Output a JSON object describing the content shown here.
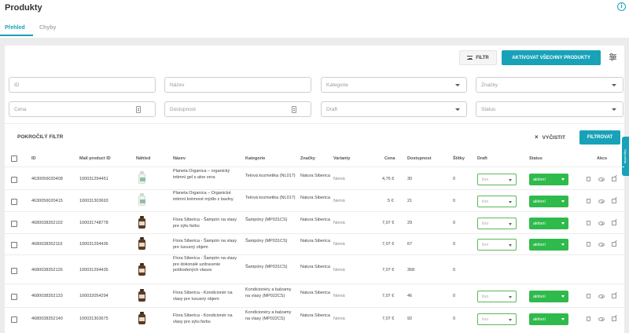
{
  "page": {
    "title": "Produkty"
  },
  "tabs": [
    {
      "label": "Přehled"
    },
    {
      "label": "Chyby"
    }
  ],
  "toolbar": {
    "filter_label": "FILTR",
    "activate_all_label": "AKTIVOVAT VŠECHNY PRODUKTY"
  },
  "filters": {
    "id_placeholder": "ID",
    "name_placeholder": "Název",
    "category_placeholder": "Kategorie",
    "brands_placeholder": "Značky",
    "price_placeholder": "Cena",
    "availability_placeholder": "Dostupnost",
    "draft_placeholder": "Draft",
    "status_placeholder": "Status",
    "advanced_label": "POKROČILÝ FILTR",
    "clear_label": "VYČISTIT",
    "apply_label": "FILTROVAT"
  },
  "table": {
    "headers": {
      "id": "ID",
      "mall_id": "Mall product ID",
      "preview": "Náhled",
      "name": "Název",
      "category": "Kategorie",
      "brands": "Značky",
      "variants": "Varianty",
      "price": "Cena",
      "availability": "Dostupnost",
      "labels": "Štítky",
      "draft": "Draft",
      "status": "Status",
      "actions": "Akce"
    },
    "rows": [
      {
        "id": "4630056020408",
        "mall_id": "100031294451",
        "name": "Planeta Organica – organický intimní gel s aloe vera",
        "category": "Telová kozmetika (NL017)",
        "brand": "Natura Siberica",
        "variant": "Nemá",
        "price": "4,76 €",
        "availability": "30",
        "labels": "0",
        "draft": "ilvo",
        "status": "aktivní"
      },
      {
        "id": "4630056020415",
        "mall_id": "100031303693",
        "name": "Planeta Organica – Organické intimní krémové mýdlo z bavlny",
        "category": "Telová kozmetika (NL017)",
        "brand": "Natura Siberica",
        "variant": "Nemá",
        "price": "5 €",
        "availability": "21",
        "labels": "0",
        "draft": "ilvo",
        "status": "aktivní"
      },
      {
        "id": "4680038352102",
        "mall_id": "100031748778",
        "name": "Flora Siberica - Šampón na vlasy pre sýtu farbu",
        "category": "Šampóny (MP031CS)",
        "brand": "Natura Siberica",
        "variant": "Nemá",
        "price": "7,07 €",
        "availability": "29",
        "labels": "0",
        "draft": "ilvo",
        "status": "aktivní"
      },
      {
        "id": "4680038352119",
        "mall_id": "100031294436",
        "name": "Flora Siberica - Šampón na vlasy pre luxusný objem",
        "category": "Šampóny (MP031CS)",
        "brand": "Natura Siberica",
        "variant": "Nemá",
        "price": "7,07 €",
        "availability": "67",
        "labels": "0",
        "draft": "ilvo",
        "status": "aktivní"
      },
      {
        "id": "4680038352126",
        "mall_id": "100031294435",
        "name": "Flora Siberica - Šampón na vlasy pre dokonalé uzdravenie poškodených vlasov",
        "category": "Šampóny (MP031CS)",
        "brand": "Natura Siberica",
        "variant": "Nemá",
        "price": "7,07 €",
        "availability": "368",
        "labels": "0",
        "draft": "ilvo",
        "status": "aktivní"
      },
      {
        "id": "4680038352133",
        "mall_id": "100032054294",
        "name": "Flora Siberica - Kondicionér na vlasy pre luxusný objem",
        "category": "Kondicionéry a balzamy na vlasy (MP022CS)",
        "brand": "Natura Siberica",
        "variant": "Nemá",
        "price": "7,07 €",
        "availability": "46",
        "labels": "0",
        "draft": "ilvo",
        "status": "aktivní"
      },
      {
        "id": "4680038352140",
        "mall_id": "100031303675",
        "name": "Flora Siberica - Kondicionér na vlasy pre sýtu farbu",
        "category": "Kondicionéry a balzamy na vlasy (MP022CS)",
        "brand": "Natura Siberica",
        "variant": "Nemá",
        "price": "7,07 €",
        "availability": "92",
        "labels": "0",
        "draft": "ilvo",
        "status": "aktivní"
      }
    ]
  },
  "side_tab": {
    "label": "Nápověda"
  },
  "colors": {
    "accent": "#17a2b8",
    "status_active": "#2fba4c"
  },
  "icons": [
    "info-icon",
    "filter-icon",
    "settings-icon",
    "chevron-down-icon",
    "close-icon",
    "trash-icon",
    "eye-icon",
    "external-link-icon"
  ]
}
